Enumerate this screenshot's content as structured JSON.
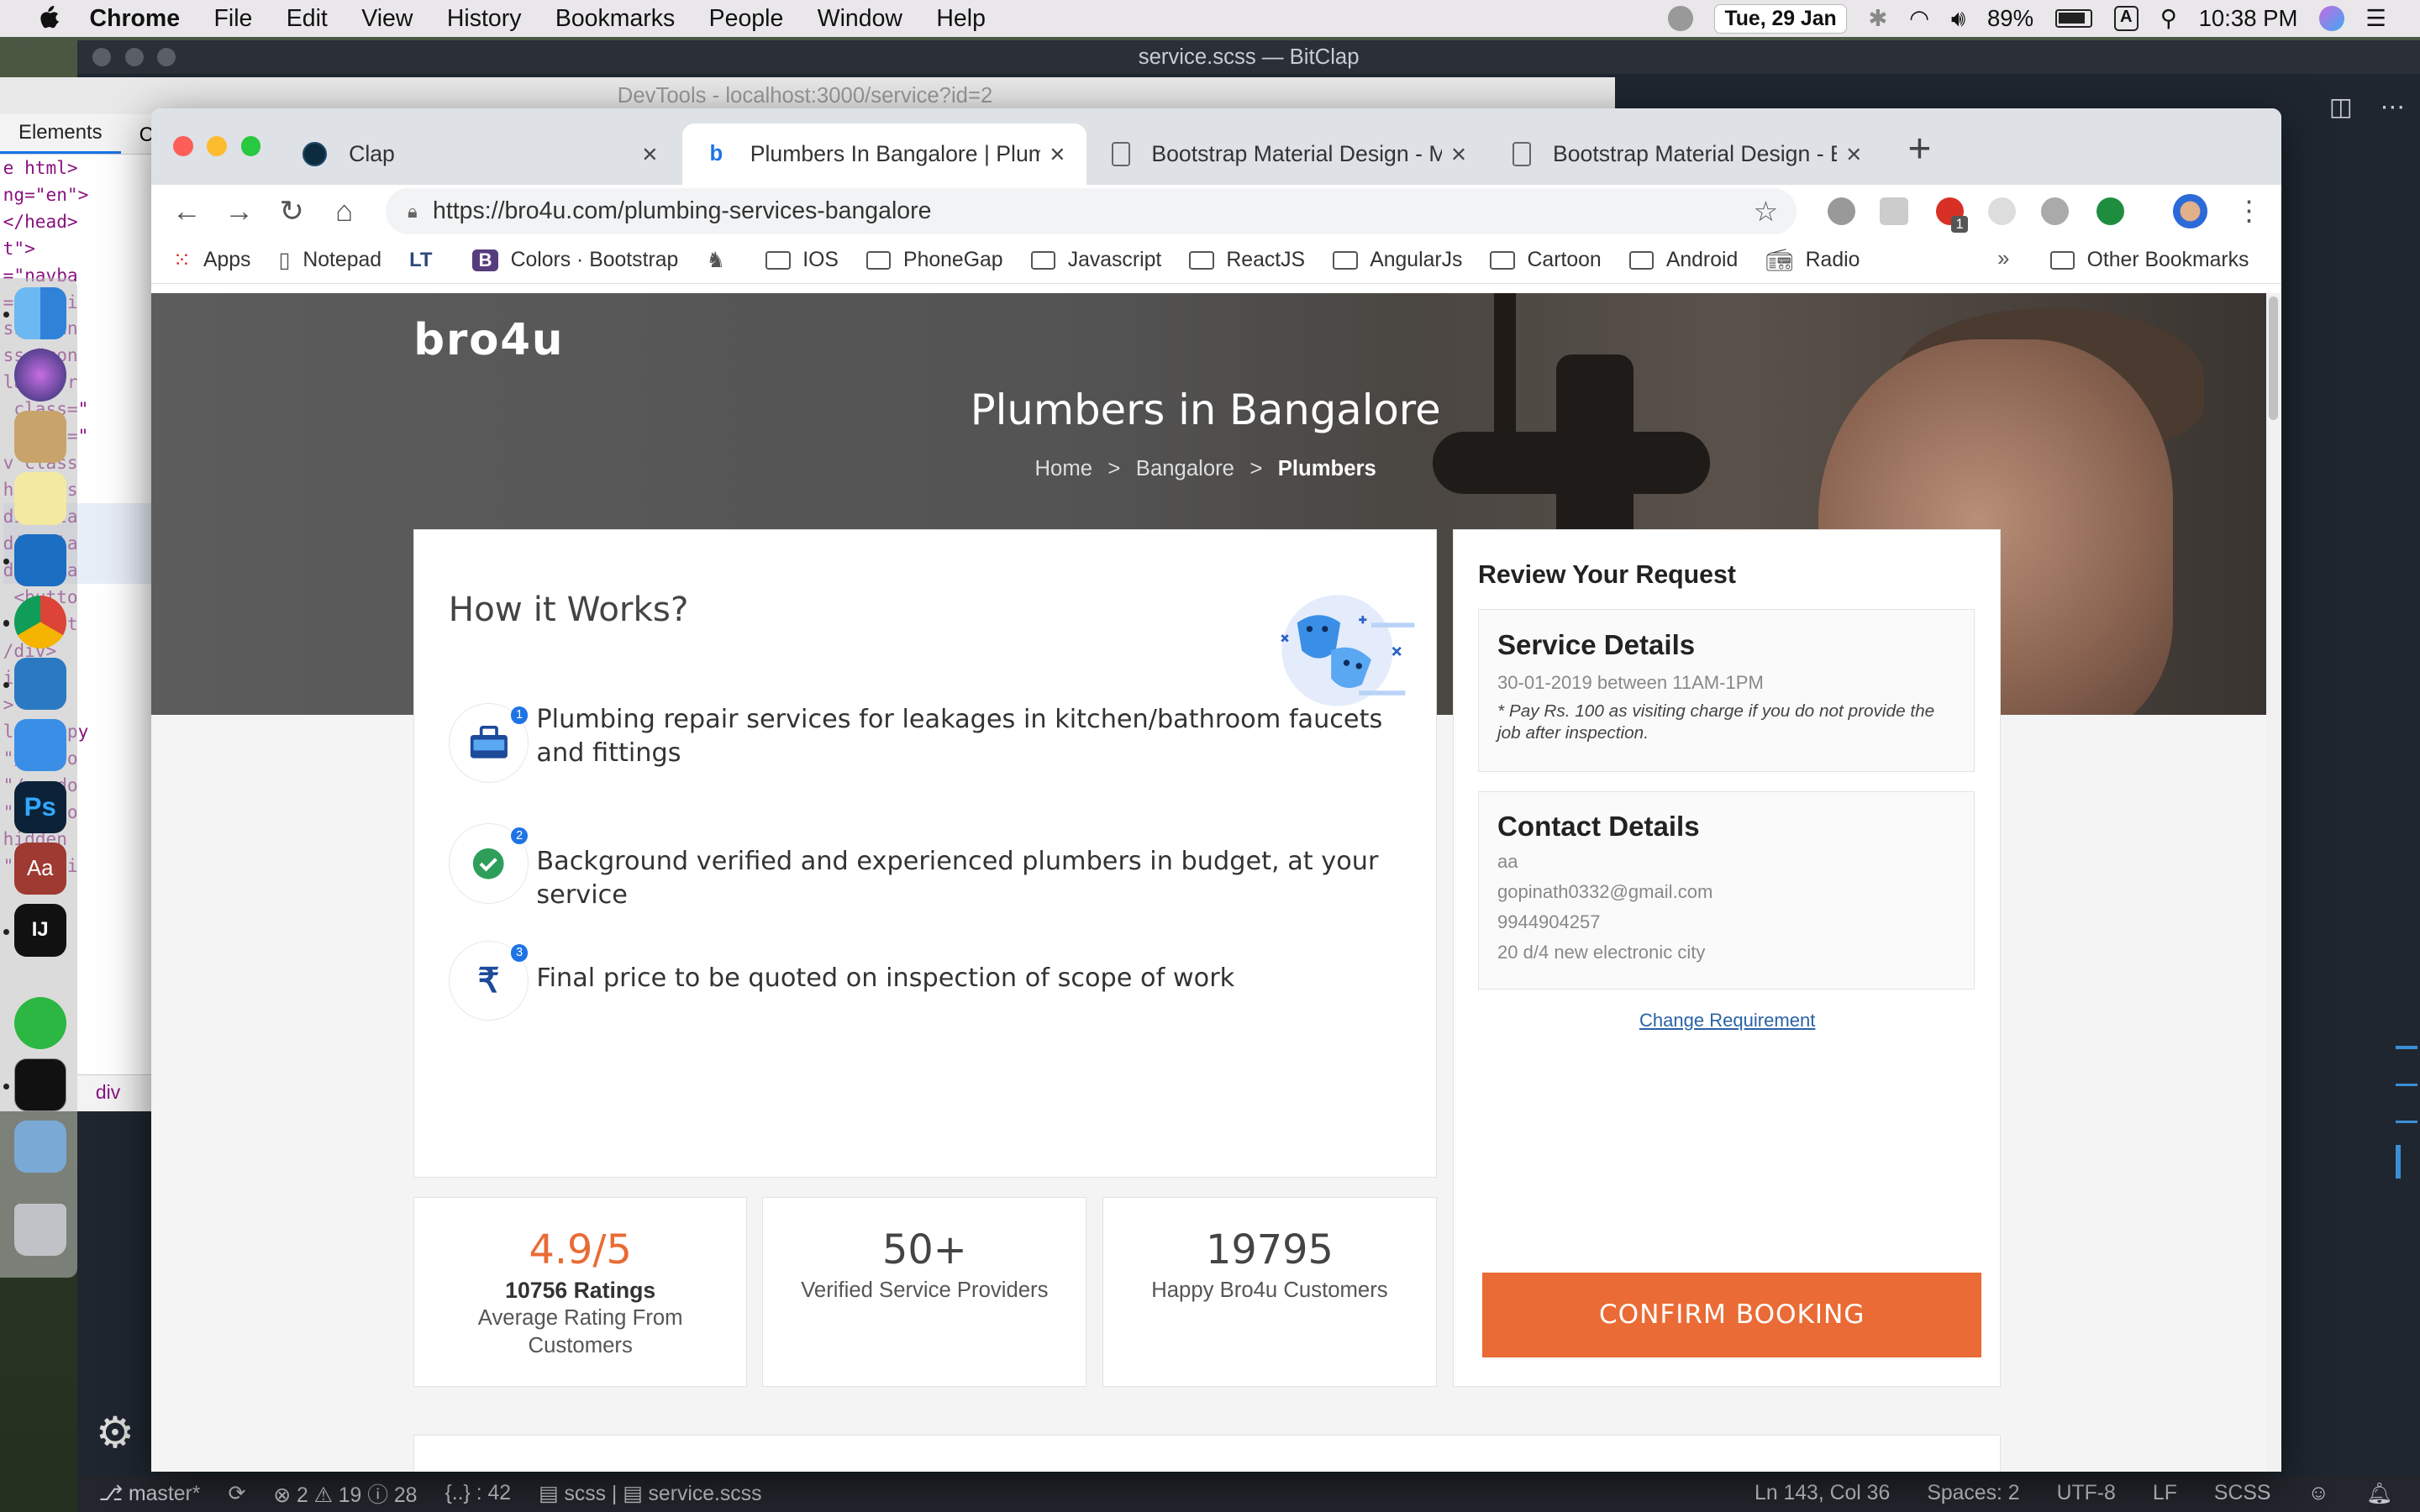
{
  "menubar": {
    "app": "Chrome",
    "items": [
      "File",
      "Edit",
      "View",
      "History",
      "Bookmarks",
      "People",
      "Window",
      "Help"
    ],
    "date": "Tue, 29 Jan",
    "battery": "89%",
    "input_source": "A",
    "time": "10:38 PM"
  },
  "editor": {
    "title": "service.scss — BitClap"
  },
  "devtools": {
    "title": "DevTools - localhost:3000/service?id=2",
    "tabs": [
      "Elements",
      "C"
    ],
    "breadcrumb": "div",
    "lines": [
      "e html>",
      "ng=\"en\">",
      "</head>",
      "",
      "t\">",
      "=\"navba",
      "=\"servi",
      "ss=\"ban",
      "",
      "ss=\"con",
      "lass=\"r",
      " class=\"",
      " class=\"",
      "v class",
      "h4 clas",
      "div cla",
      "div cla",
      "div cla",
      " <butto",
      " </butt",
      "/div>",
      "iv>",
      ">",
      "",
      "",
      "lass=\"py",
      "",
      "\"/vendo",
      "\"/vendo",
      "\"/vendo",
      "hidden",
      "\"/stati"
    ]
  },
  "status_bar": {
    "branch": "master*",
    "errors": "2",
    "warnings": "19",
    "infos": "28",
    "symbols": "{..} : 42",
    "language_mode": "scss",
    "file": "service.scss",
    "position": "Ln 143, Col 36",
    "spaces": "Spaces: 2",
    "encoding": "UTF-8",
    "eol": "LF",
    "lang": "SCSS"
  },
  "chrome": {
    "tabs": [
      {
        "title": "Clap",
        "active": false
      },
      {
        "title": "Plumbers In Bangalore | Plumbers",
        "active": true
      },
      {
        "title": "Bootstrap Material Design - Material",
        "active": false
      },
      {
        "title": "Bootstrap Material Design - Buttons",
        "active": false
      }
    ],
    "url": "https://bro4u.com/plumbing-services-bangalore",
    "ext_badge": "1",
    "bookmarks": [
      {
        "label": "Apps",
        "icon": "apps-grid-icon"
      },
      {
        "label": "Notepad",
        "icon": "page-icon"
      },
      {
        "label": "",
        "icon": "lt-icon"
      },
      {
        "label": "Colors · Bootstrap",
        "icon": "bootstrap-icon"
      },
      {
        "label": "",
        "icon": "horse-icon"
      },
      {
        "label": "IOS",
        "icon": "folder-icon"
      },
      {
        "label": "PhoneGap",
        "icon": "folder-icon"
      },
      {
        "label": "Javascript",
        "icon": "folder-icon"
      },
      {
        "label": "ReactJS",
        "icon": "folder-icon"
      },
      {
        "label": "AngularJs",
        "icon": "folder-icon"
      },
      {
        "label": "Cartoon",
        "icon": "folder-icon"
      },
      {
        "label": "Android",
        "icon": "folder-icon"
      },
      {
        "label": "Radio",
        "icon": "radio-icon"
      }
    ],
    "more": "»",
    "other_bookmarks": "Other Bookmarks"
  },
  "page": {
    "logo": "bro4u",
    "title": "Plumbers in Bangalore",
    "breadcrumb": [
      "Home",
      "Bangalore",
      "Plumbers"
    ],
    "how": {
      "heading": "How it Works?",
      "steps": [
        {
          "num": "1",
          "text": "Plumbing repair services for leakages in kitchen/bathroom faucets and fittings",
          "icon": "toolbox-icon"
        },
        {
          "num": "2",
          "text": "Background verified and experienced plumbers in budget, at your service",
          "icon": "verified-check-icon"
        },
        {
          "num": "3",
          "text": "Final price to be quoted on inspection of scope of work",
          "icon": "rupee-icon"
        }
      ]
    },
    "stats": [
      {
        "big": "4.9/5",
        "bold": "10756 Ratings",
        "label": "Average Rating From Customers"
      },
      {
        "big": "50+",
        "bold": "",
        "label": "Verified Service Providers"
      },
      {
        "big": "19795",
        "bold": "",
        "label": "Happy Bro4u Customers"
      }
    ],
    "review": {
      "heading": "Review Your Request",
      "service": {
        "title": "Service Details",
        "slot": "30-01-2019 between 11AM-1PM",
        "note": "* Pay Rs. 100 as visiting charge if you do not provide the job after inspection."
      },
      "contact": {
        "title": "Contact Details",
        "name": "aa",
        "email": "gopinath0332@gmail.com",
        "phone": "9944904257",
        "address": "20 d/4 new electronic city"
      },
      "change_link": "Change Requirement",
      "confirm": "CONFIRM BOOKING"
    }
  },
  "colors": {
    "accent": "#ea6b35",
    "rating": "#e96b34",
    "step_badge": "#1e74e6",
    "link": "#2a62a6"
  }
}
